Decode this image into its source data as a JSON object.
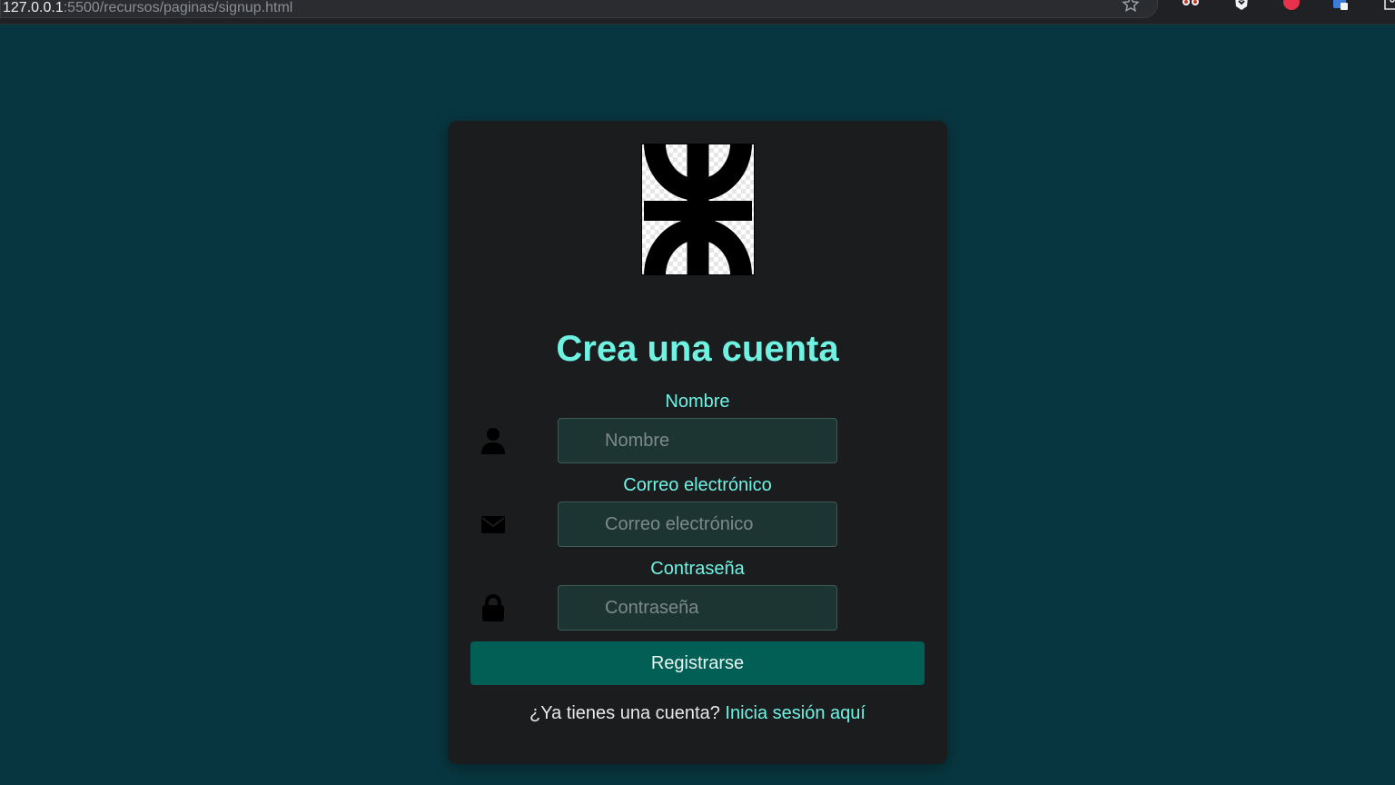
{
  "browser": {
    "url_host": "127.0.0.1",
    "url_path": ":5500/recursos/paginas/signup.html"
  },
  "form": {
    "title": "Crea una cuenta",
    "fields": [
      {
        "label": "Nombre",
        "placeholder": "Nombre",
        "icon": "user-icon"
      },
      {
        "label": "Correo electrónico",
        "placeholder": "Correo electrónico",
        "icon": "envelope-icon"
      },
      {
        "label": "Contraseña",
        "placeholder": "Contraseña",
        "icon": "lock-icon"
      }
    ],
    "submit_label": "Registrarse",
    "login_prompt": "¿Ya tienes una cuenta?",
    "login_link": "Inicia sesión aquí"
  },
  "colors": {
    "page_bg": "#083640",
    "card_bg": "#1b1c1e",
    "accent": "#6ff2e2",
    "button_bg": "#015f56",
    "input_bg": "#1c3533"
  }
}
